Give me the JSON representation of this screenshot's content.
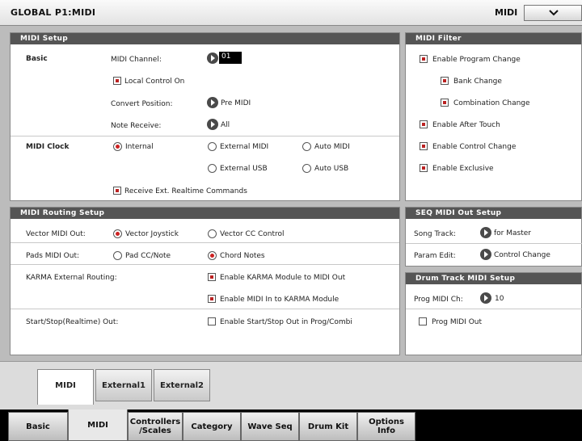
{
  "header": {
    "title": "GLOBAL P1:MIDI",
    "mode_label": "MIDI"
  },
  "midi_setup": {
    "heading": "MIDI Setup",
    "basic_label": "Basic",
    "midi_channel_label": "MIDI Channel:",
    "midi_channel_value": "01",
    "local_control_label": "Local Control On",
    "convert_position_label": "Convert Position:",
    "convert_position_value": "Pre MIDI",
    "note_receive_label": "Note Receive:",
    "note_receive_value": "All",
    "midi_clock_label": "MIDI Clock",
    "clock_internal": "Internal",
    "clock_external_midi": "External MIDI",
    "clock_auto_midi": "Auto MIDI",
    "clock_external_usb": "External USB",
    "clock_auto_usb": "Auto USB",
    "receive_ext_label": "Receive Ext. Realtime Commands"
  },
  "midi_filter": {
    "heading": "MIDI Filter",
    "items": [
      "Enable Program Change",
      "Bank Change",
      "Combination Change",
      "Enable After Touch",
      "Enable Control Change",
      "Enable Exclusive"
    ]
  },
  "routing": {
    "heading": "MIDI Routing Setup",
    "vector_label": "Vector MIDI Out:",
    "vector_joystick": "Vector Joystick",
    "vector_cc": "Vector CC Control",
    "pads_label": "Pads MIDI Out:",
    "pad_cc": "Pad CC/Note",
    "chord_notes": "Chord Notes",
    "karma_label": "KARMA External Routing:",
    "karma_module_out": "Enable KARMA Module to MIDI Out",
    "midi_in_karma": "Enable MIDI In to KARMA Module",
    "startstop_label": "Start/Stop(Realtime) Out:",
    "startstop_enable": "Enable Start/Stop Out in Prog/Combi"
  },
  "seq_out": {
    "heading": "SEQ MIDI Out Setup",
    "song_track_label": "Song Track:",
    "song_track_value": "for Master",
    "param_edit_label": "Param Edit:",
    "param_edit_value": "Control Change"
  },
  "drum_track": {
    "heading": "Drum Track MIDI Setup",
    "prog_ch_label": "Prog MIDI Ch:",
    "prog_ch_value": "10",
    "prog_out_label": "Prog MIDI Out"
  },
  "sub_tabs": [
    "MIDI",
    "External1",
    "External2"
  ],
  "page_tabs": [
    "Basic",
    "MIDI",
    "Controllers /Scales",
    "Category",
    "Wave Seq",
    "Drum Kit",
    "Options Info"
  ],
  "colors": {
    "header_bar": "#555555",
    "check_on": "#b22222",
    "tab_bar": "#000000"
  }
}
